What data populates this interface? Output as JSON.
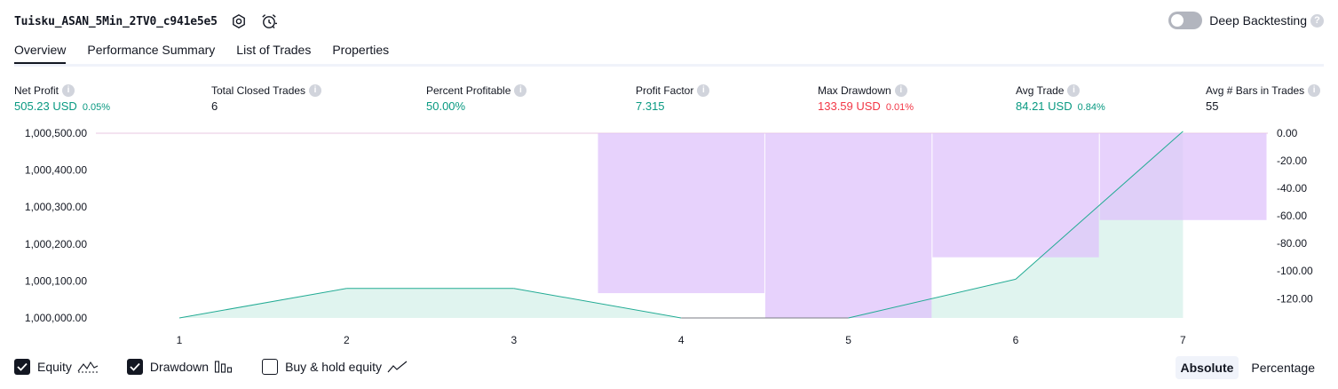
{
  "header": {
    "title": "Tuisku_ASAN_5Min_2TV0_c941e5e5",
    "settings_icon": "gear-icon",
    "alert_icon": "alarm-clock-icon"
  },
  "deep_backtesting": {
    "label": "Deep Backtesting",
    "enabled": false,
    "help": "?"
  },
  "tabs": [
    {
      "label": "Overview",
      "active": true
    },
    {
      "label": "Performance Summary",
      "active": false
    },
    {
      "label": "List of Trades",
      "active": false
    },
    {
      "label": "Properties",
      "active": false
    }
  ],
  "info_glyph": "i",
  "metrics": [
    {
      "label": "Net Profit",
      "value": "505.23 USD",
      "pct": "0.05%",
      "tone": "pos"
    },
    {
      "label": "Total Closed Trades",
      "value": "6",
      "pct": "",
      "tone": "neutral"
    },
    {
      "label": "Percent Profitable",
      "value": "50.00%",
      "pct": "",
      "tone": "pos"
    },
    {
      "label": "Profit Factor",
      "value": "7.315",
      "pct": "",
      "tone": "pos"
    },
    {
      "label": "Max Drawdown",
      "value": "133.59 USD",
      "pct": "0.01%",
      "tone": "neg"
    },
    {
      "label": "Avg Trade",
      "value": "84.21 USD",
      "pct": "0.84%",
      "tone": "pos"
    },
    {
      "label": "Avg # Bars in Trades",
      "value": "55",
      "pct": "",
      "tone": "neutral"
    }
  ],
  "chart_data": {
    "type": "line",
    "x": [
      1,
      2,
      3,
      4,
      5,
      6,
      7
    ],
    "x_tick_labels": [
      "1",
      "2",
      "3",
      "4",
      "5",
      "6",
      "7"
    ],
    "y_left_ticks": [
      "1,000,500.00",
      "1,000,400.00",
      "1,000,300.00",
      "1,000,200.00",
      "1,000,100.00",
      "1,000,000.00"
    ],
    "y_left_range": [
      1000000,
      1000500
    ],
    "y_right_ticks": [
      "0.00",
      "-20.00",
      "-40.00",
      "-60.00",
      "-80.00",
      "-100.00",
      "-120.00"
    ],
    "y_right_range": [
      -134,
      0
    ],
    "series": [
      {
        "name": "Equity",
        "axis": "left",
        "x": [
          1,
          2,
          3,
          4,
          5,
          6,
          7
        ],
        "values": [
          1000000,
          1000080,
          1000080,
          1000000,
          1000000,
          1000105,
          1000505
        ]
      },
      {
        "name": "Drawdown",
        "axis": "right",
        "type": "bar",
        "x": [
          4,
          5,
          6,
          7
        ],
        "values": [
          -116,
          -134,
          -90,
          -63
        ]
      }
    ],
    "colors": {
      "equity_line": "#22ab94",
      "equity_fill": "#e0f4ef",
      "drawdown_fill": "#dfc3fb",
      "flat_line": "#787b86"
    }
  },
  "legend": [
    {
      "label": "Equity",
      "checked": true,
      "icon": "equity-line-icon"
    },
    {
      "label": "Drawdown",
      "checked": true,
      "icon": "drawdown-bars-icon"
    },
    {
      "label": "Buy & hold equity",
      "checked": false,
      "icon": "buyhold-line-icon"
    }
  ],
  "mode": [
    {
      "label": "Absolute",
      "active": true
    },
    {
      "label": "Percentage",
      "active": false
    }
  ]
}
